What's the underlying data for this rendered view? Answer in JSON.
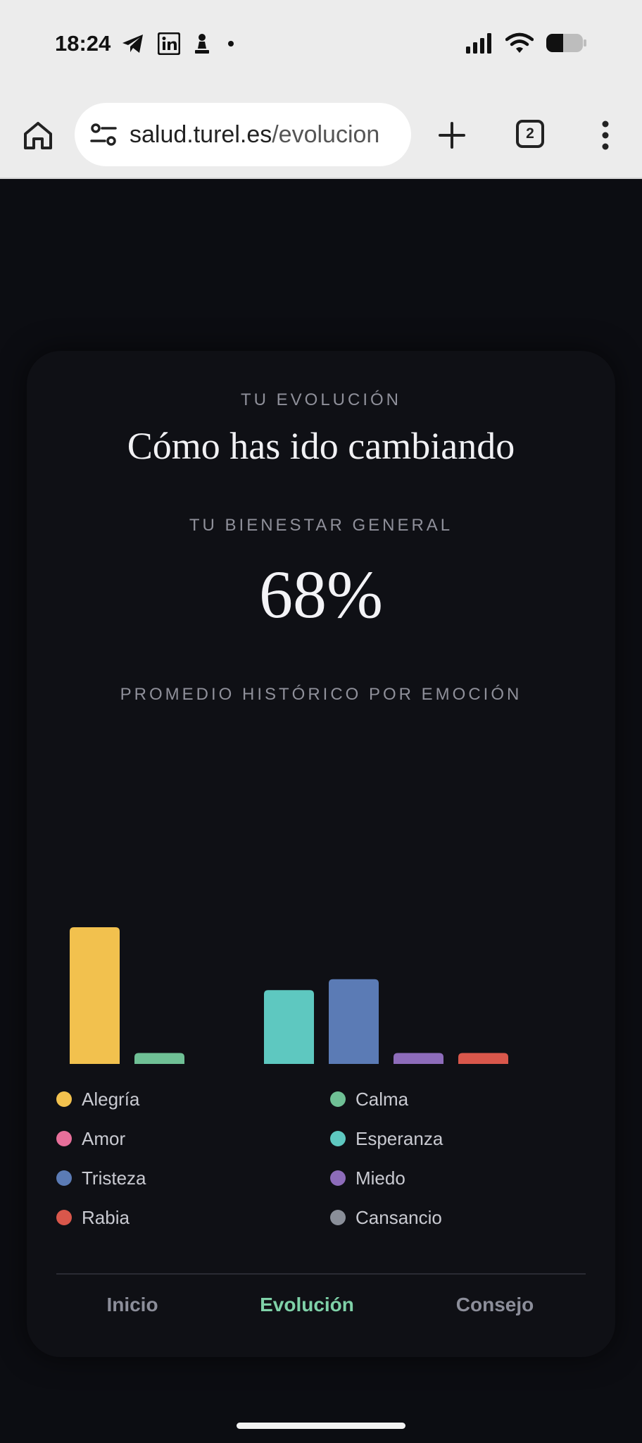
{
  "status_bar": {
    "time": "18:24",
    "left_icons": [
      "telegram-icon",
      "linkedin-icon",
      "chess-pawn-icon",
      "dot-icon"
    ],
    "right_icons": [
      "signal-icon",
      "wifi-icon",
      "battery-icon"
    ]
  },
  "browser": {
    "url_host": "salud.turel.es",
    "url_path": "/evolucion",
    "tab_count": "2"
  },
  "page": {
    "eyebrow": "TU EVOLUCIÓN",
    "title": "Cómo has ido cambiando",
    "wellbeing_label": "TU BIENESTAR GENERAL",
    "wellbeing_value": "68%",
    "chart_heading": "PROMEDIO HISTÓRICO POR EMOCIÓN"
  },
  "chart_data": {
    "type": "bar",
    "title": "PROMEDIO HISTÓRICO POR EMOCIÓN",
    "categories": [
      "Alegría",
      "Calma",
      "Amor",
      "Esperanza",
      "Tristeza",
      "Miedo",
      "Rabia",
      "Cansancio"
    ],
    "values": [
      100,
      8,
      0,
      54,
      62,
      8,
      8,
      0
    ],
    "ylim": [
      0,
      100
    ],
    "colors": [
      "#f2c14e",
      "#6fc095",
      "#e76f9a",
      "#5ec8c0",
      "#5b7bb5",
      "#8d6cba",
      "#d9574b",
      "#8a8f99"
    ],
    "grid": false,
    "axes_visible": false
  },
  "legend": {
    "items": [
      {
        "label": "Alegría",
        "color": "#f2c14e"
      },
      {
        "label": "Calma",
        "color": "#6fc095"
      },
      {
        "label": "Amor",
        "color": "#e76f9a"
      },
      {
        "label": "Esperanza",
        "color": "#5ec8c0"
      },
      {
        "label": "Tristeza",
        "color": "#5b7bb5"
      },
      {
        "label": "Miedo",
        "color": "#8d6cba"
      },
      {
        "label": "Rabia",
        "color": "#d9574b"
      },
      {
        "label": "Cansancio",
        "color": "#8a8f99"
      }
    ]
  },
  "nav": {
    "items": [
      {
        "label": "Inicio",
        "active": false
      },
      {
        "label": "Evolución",
        "active": true
      },
      {
        "label": "Consejo",
        "active": false
      }
    ],
    "active_color": "#7fd1a8",
    "inactive_color": "#8c8e9a"
  }
}
